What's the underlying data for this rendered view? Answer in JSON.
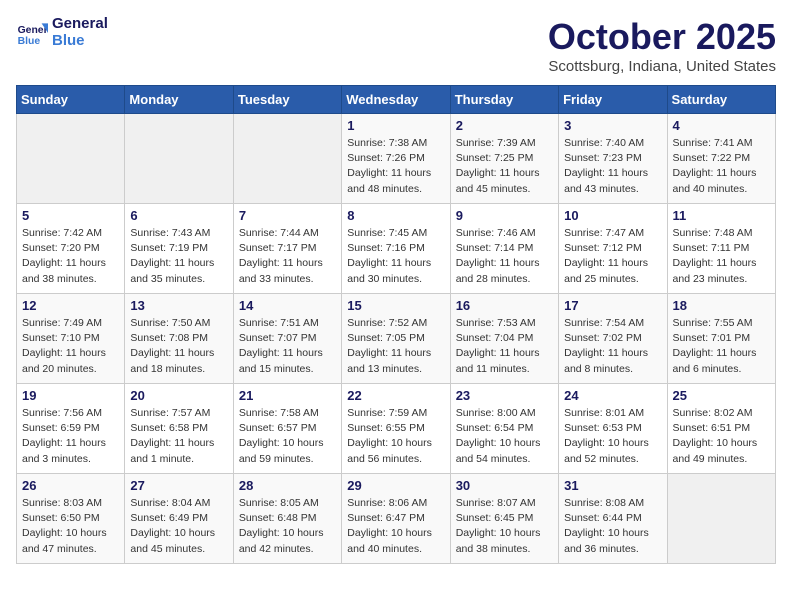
{
  "header": {
    "logo_line1": "General",
    "logo_line2": "Blue",
    "month": "October 2025",
    "location": "Scottsburg, Indiana, United States"
  },
  "weekdays": [
    "Sunday",
    "Monday",
    "Tuesday",
    "Wednesday",
    "Thursday",
    "Friday",
    "Saturday"
  ],
  "weeks": [
    [
      {
        "day": "",
        "info": ""
      },
      {
        "day": "",
        "info": ""
      },
      {
        "day": "",
        "info": ""
      },
      {
        "day": "1",
        "info": "Sunrise: 7:38 AM\nSunset: 7:26 PM\nDaylight: 11 hours\nand 48 minutes."
      },
      {
        "day": "2",
        "info": "Sunrise: 7:39 AM\nSunset: 7:25 PM\nDaylight: 11 hours\nand 45 minutes."
      },
      {
        "day": "3",
        "info": "Sunrise: 7:40 AM\nSunset: 7:23 PM\nDaylight: 11 hours\nand 43 minutes."
      },
      {
        "day": "4",
        "info": "Sunrise: 7:41 AM\nSunset: 7:22 PM\nDaylight: 11 hours\nand 40 minutes."
      }
    ],
    [
      {
        "day": "5",
        "info": "Sunrise: 7:42 AM\nSunset: 7:20 PM\nDaylight: 11 hours\nand 38 minutes."
      },
      {
        "day": "6",
        "info": "Sunrise: 7:43 AM\nSunset: 7:19 PM\nDaylight: 11 hours\nand 35 minutes."
      },
      {
        "day": "7",
        "info": "Sunrise: 7:44 AM\nSunset: 7:17 PM\nDaylight: 11 hours\nand 33 minutes."
      },
      {
        "day": "8",
        "info": "Sunrise: 7:45 AM\nSunset: 7:16 PM\nDaylight: 11 hours\nand 30 minutes."
      },
      {
        "day": "9",
        "info": "Sunrise: 7:46 AM\nSunset: 7:14 PM\nDaylight: 11 hours\nand 28 minutes."
      },
      {
        "day": "10",
        "info": "Sunrise: 7:47 AM\nSunset: 7:12 PM\nDaylight: 11 hours\nand 25 minutes."
      },
      {
        "day": "11",
        "info": "Sunrise: 7:48 AM\nSunset: 7:11 PM\nDaylight: 11 hours\nand 23 minutes."
      }
    ],
    [
      {
        "day": "12",
        "info": "Sunrise: 7:49 AM\nSunset: 7:10 PM\nDaylight: 11 hours\nand 20 minutes."
      },
      {
        "day": "13",
        "info": "Sunrise: 7:50 AM\nSunset: 7:08 PM\nDaylight: 11 hours\nand 18 minutes."
      },
      {
        "day": "14",
        "info": "Sunrise: 7:51 AM\nSunset: 7:07 PM\nDaylight: 11 hours\nand 15 minutes."
      },
      {
        "day": "15",
        "info": "Sunrise: 7:52 AM\nSunset: 7:05 PM\nDaylight: 11 hours\nand 13 minutes."
      },
      {
        "day": "16",
        "info": "Sunrise: 7:53 AM\nSunset: 7:04 PM\nDaylight: 11 hours\nand 11 minutes."
      },
      {
        "day": "17",
        "info": "Sunrise: 7:54 AM\nSunset: 7:02 PM\nDaylight: 11 hours\nand 8 minutes."
      },
      {
        "day": "18",
        "info": "Sunrise: 7:55 AM\nSunset: 7:01 PM\nDaylight: 11 hours\nand 6 minutes."
      }
    ],
    [
      {
        "day": "19",
        "info": "Sunrise: 7:56 AM\nSunset: 6:59 PM\nDaylight: 11 hours\nand 3 minutes."
      },
      {
        "day": "20",
        "info": "Sunrise: 7:57 AM\nSunset: 6:58 PM\nDaylight: 11 hours\nand 1 minute."
      },
      {
        "day": "21",
        "info": "Sunrise: 7:58 AM\nSunset: 6:57 PM\nDaylight: 10 hours\nand 59 minutes."
      },
      {
        "day": "22",
        "info": "Sunrise: 7:59 AM\nSunset: 6:55 PM\nDaylight: 10 hours\nand 56 minutes."
      },
      {
        "day": "23",
        "info": "Sunrise: 8:00 AM\nSunset: 6:54 PM\nDaylight: 10 hours\nand 54 minutes."
      },
      {
        "day": "24",
        "info": "Sunrise: 8:01 AM\nSunset: 6:53 PM\nDaylight: 10 hours\nand 52 minutes."
      },
      {
        "day": "25",
        "info": "Sunrise: 8:02 AM\nSunset: 6:51 PM\nDaylight: 10 hours\nand 49 minutes."
      }
    ],
    [
      {
        "day": "26",
        "info": "Sunrise: 8:03 AM\nSunset: 6:50 PM\nDaylight: 10 hours\nand 47 minutes."
      },
      {
        "day": "27",
        "info": "Sunrise: 8:04 AM\nSunset: 6:49 PM\nDaylight: 10 hours\nand 45 minutes."
      },
      {
        "day": "28",
        "info": "Sunrise: 8:05 AM\nSunset: 6:48 PM\nDaylight: 10 hours\nand 42 minutes."
      },
      {
        "day": "29",
        "info": "Sunrise: 8:06 AM\nSunset: 6:47 PM\nDaylight: 10 hours\nand 40 minutes."
      },
      {
        "day": "30",
        "info": "Sunrise: 8:07 AM\nSunset: 6:45 PM\nDaylight: 10 hours\nand 38 minutes."
      },
      {
        "day": "31",
        "info": "Sunrise: 8:08 AM\nSunset: 6:44 PM\nDaylight: 10 hours\nand 36 minutes."
      },
      {
        "day": "",
        "info": ""
      }
    ]
  ]
}
